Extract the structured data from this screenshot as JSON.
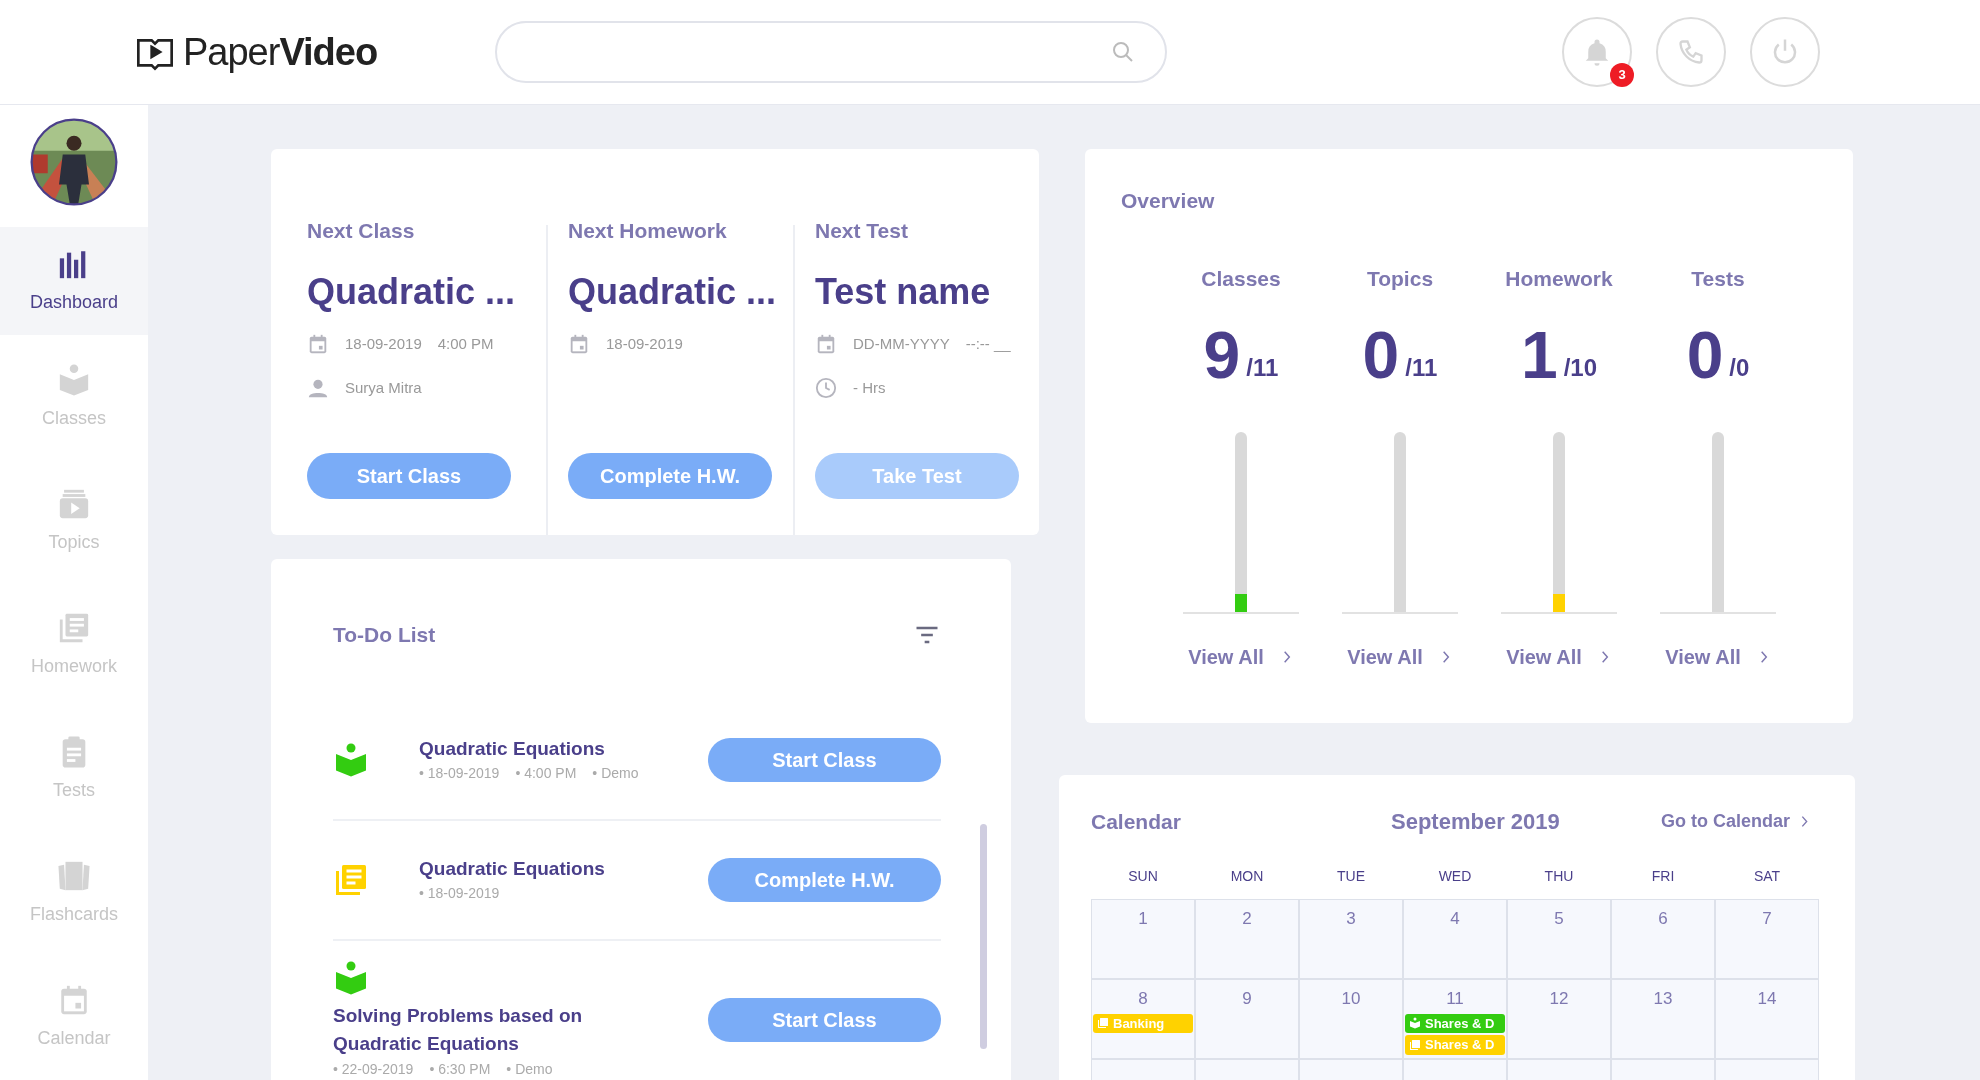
{
  "header": {
    "logo": "Paper**Video**",
    "notifications": "3"
  },
  "sidebar": {
    "items": [
      {
        "label": "Dashboard",
        "selected": true
      },
      {
        "label": "Classes",
        "selected": false
      },
      {
        "label": "Topics",
        "selected": false
      },
      {
        "label": "Homework",
        "selected": false
      },
      {
        "label": "Tests",
        "selected": false
      },
      {
        "label": "Flashcards",
        "selected": false
      },
      {
        "label": "Calendar",
        "selected": false
      }
    ]
  },
  "next": [
    {
      "label": "Next Class",
      "title": "Quadratic ...",
      "rows": [
        {
          "kind": "date",
          "texts": [
            "18-09-2019",
            "4:00 PM"
          ]
        },
        {
          "kind": "person",
          "texts": [
            "Surya Mitra"
          ]
        }
      ],
      "button": {
        "label": "Start Class",
        "disabled": false
      }
    },
    {
      "label": "Next Homework",
      "title": "Quadratic ...",
      "rows": [
        {
          "kind": "date",
          "texts": [
            "18-09-2019"
          ]
        }
      ],
      "button": {
        "label": "Complete H.W.",
        "disabled": false
      }
    },
    {
      "label": "Next Test",
      "title": "Test name",
      "rows": [
        {
          "kind": "date",
          "texts": [
            "DD-MM-YYYY",
            "--:-- __"
          ]
        },
        {
          "kind": "time",
          "texts": [
            "- Hrs"
          ]
        }
      ],
      "button": {
        "label": "Take Test",
        "disabled": true
      }
    }
  ],
  "overview": {
    "title": "Overview",
    "stats": [
      {
        "label": "Classes",
        "value": "9",
        "total": "/11",
        "level": 0.1,
        "color": "#33cc11",
        "link": "View All"
      },
      {
        "label": "Topics",
        "value": "0",
        "total": "/11",
        "level": 0,
        "link": "View All"
      },
      {
        "label": "Homework",
        "value": "1",
        "total": "/10",
        "level": 0.1,
        "color": "#ffd200",
        "link": "View All"
      },
      {
        "label": "Tests",
        "value": "0",
        "total": "/0",
        "level": 0,
        "link": "View All"
      }
    ]
  },
  "todo": {
    "title": "To-Do List",
    "items": [
      {
        "kind": "class",
        "title": "Quadratic Equations",
        "meta": [
          "• 18-09-2019",
          "• 4:00 PM",
          "• Demo"
        ],
        "button": "Start Class"
      },
      {
        "kind": "homework",
        "title": "Quadratic Equations",
        "meta": [
          "• 18-09-2019"
        ],
        "button": "Complete H.W."
      },
      {
        "kind": "class",
        "title": "Solving Problems based on Quadratic Equations",
        "meta": [
          "• 22-09-2019",
          "• 6:30 PM",
          "• Demo"
        ],
        "button": "Start Class"
      }
    ]
  },
  "calendar": {
    "title": "Calendar",
    "month": "September 2019",
    "link": "Go to Calendar",
    "weekdays": [
      "SUN",
      "MON",
      "TUE",
      "WED",
      "THU",
      "FRI",
      "SAT"
    ],
    "weeks": [
      [
        {
          "day": "1"
        },
        {
          "day": "2"
        },
        {
          "day": "3"
        },
        {
          "day": "4"
        },
        {
          "day": "5"
        },
        {
          "day": "6"
        },
        {
          "day": "7"
        }
      ],
      [
        {
          "day": "8",
          "events": [
            {
              "kind": "homework",
              "label": "Banking",
              "color": "#ffd200"
            }
          ]
        },
        {
          "day": "9"
        },
        {
          "day": "10"
        },
        {
          "day": "11",
          "events": [
            {
              "kind": "class",
              "label": "Shares & D",
              "color": "#33cc11"
            },
            {
              "kind": "homework",
              "label": "Shares & D",
              "color": "#ffd200"
            }
          ]
        },
        {
          "day": "12"
        },
        {
          "day": "13"
        },
        {
          "day": "14"
        }
      ]
    ]
  }
}
